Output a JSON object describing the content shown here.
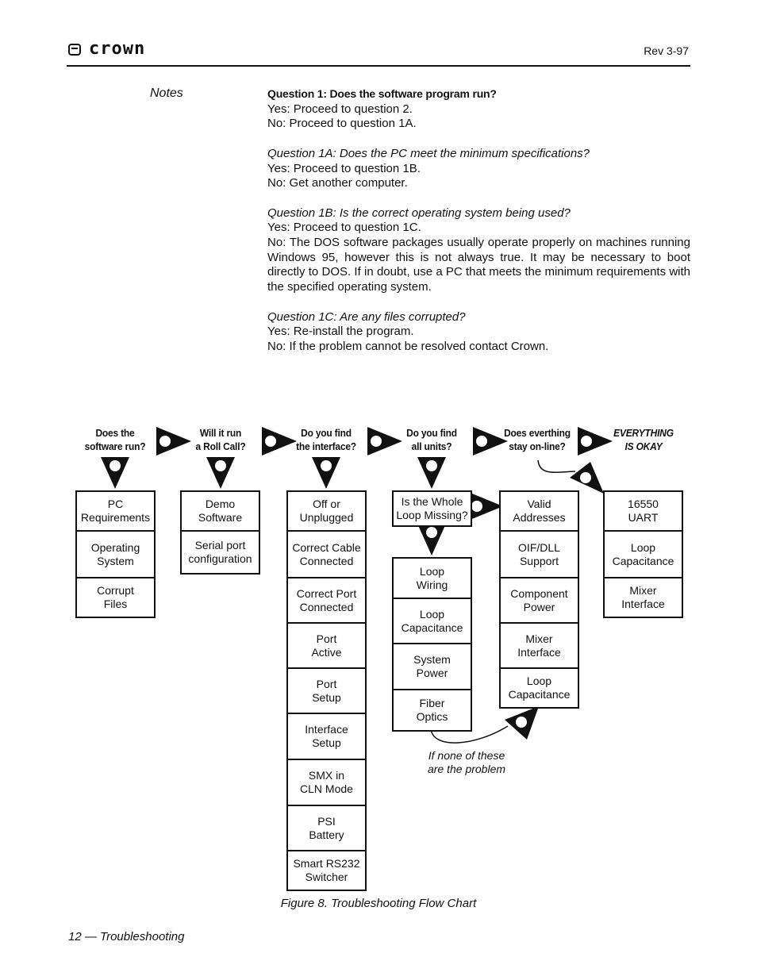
{
  "header": {
    "brand": "crown",
    "revision": "Rev 3-97"
  },
  "notes_label": "Notes",
  "questions": [
    {
      "title": "Question 1: Does the software program run?",
      "style": "bold",
      "lines": [
        "Yes: Proceed to question 2.",
        "No: Proceed to question 1A."
      ]
    },
    {
      "title": "Question 1A: Does the PC meet the minimum specifications?",
      "style": "italic",
      "lines": [
        "Yes: Proceed to question 1B.",
        "No: Get another computer."
      ]
    },
    {
      "title": "Question 1B: Is the correct operating system being used?",
      "style": "italic",
      "lines": [
        "Yes: Proceed to question 1C.",
        "No: The DOS software packages usually operate properly on machines running Windows 95, however this is not always true. It may be necessary to boot directly to DOS. If in doubt, use a PC that meets the minimum requirements with the specified operating system."
      ]
    },
    {
      "title": "Question 1C: Are any files corrupted?",
      "style": "italic",
      "lines": [
        "Yes: Re-install the program.",
        "No: If the problem cannot be resolved contact Crown."
      ]
    }
  ],
  "flowchart": {
    "steps": [
      {
        "question": [
          "Does the",
          "software run?"
        ],
        "items": [
          [
            "PC",
            "Requirements"
          ],
          [
            "Operating",
            "System"
          ],
          [
            "Corrupt",
            "Files"
          ]
        ]
      },
      {
        "question": [
          "Will it run",
          "a Roll Call?"
        ],
        "items": [
          [
            "Demo",
            "Software"
          ],
          [
            "Serial port",
            "configuration"
          ]
        ]
      },
      {
        "question": [
          "Do you find",
          "the interface?"
        ],
        "items": [
          [
            "Off or",
            "Unplugged"
          ],
          [
            "Correct Cable",
            "Connected"
          ],
          [
            "Correct Port",
            "Connected"
          ],
          [
            "Port",
            "Active"
          ],
          [
            "Port",
            "Setup"
          ],
          [
            "Interface",
            "Setup"
          ],
          [
            "SMX in",
            "CLN Mode"
          ],
          [
            "PSI",
            "Battery"
          ],
          [
            "Smart RS232",
            "Switcher"
          ]
        ]
      },
      {
        "question": [
          "Do you find",
          "all units?"
        ],
        "decision": [
          "Is the Whole",
          "Loop Missing?"
        ],
        "items": [
          [
            "Loop",
            "Wiring"
          ],
          [
            "Loop",
            "Capacitance"
          ],
          [
            "System",
            "Power"
          ],
          [
            "Fiber",
            "Optics"
          ]
        ]
      },
      {
        "question": [
          "Does everthing",
          "stay on-line?"
        ],
        "items": [
          [
            "Valid",
            "Addresses"
          ],
          [
            "OIF/DLL",
            "Support"
          ],
          [
            "Component",
            "Power"
          ],
          [
            "Mixer",
            "Interface"
          ],
          [
            "Loop",
            "Capacitance"
          ]
        ]
      },
      {
        "question": [
          "EVERYTHING",
          "IS OKAY"
        ],
        "items": [
          [
            "16550",
            "UART"
          ],
          [
            "Loop",
            "Capacitance"
          ],
          [
            "Mixer",
            "Interface"
          ]
        ]
      }
    ],
    "loop_note": [
      "If none of these",
      "are the problem"
    ]
  },
  "caption": "Figure 8. Troubleshooting Flow Chart",
  "footer": "12 — Troubleshooting"
}
